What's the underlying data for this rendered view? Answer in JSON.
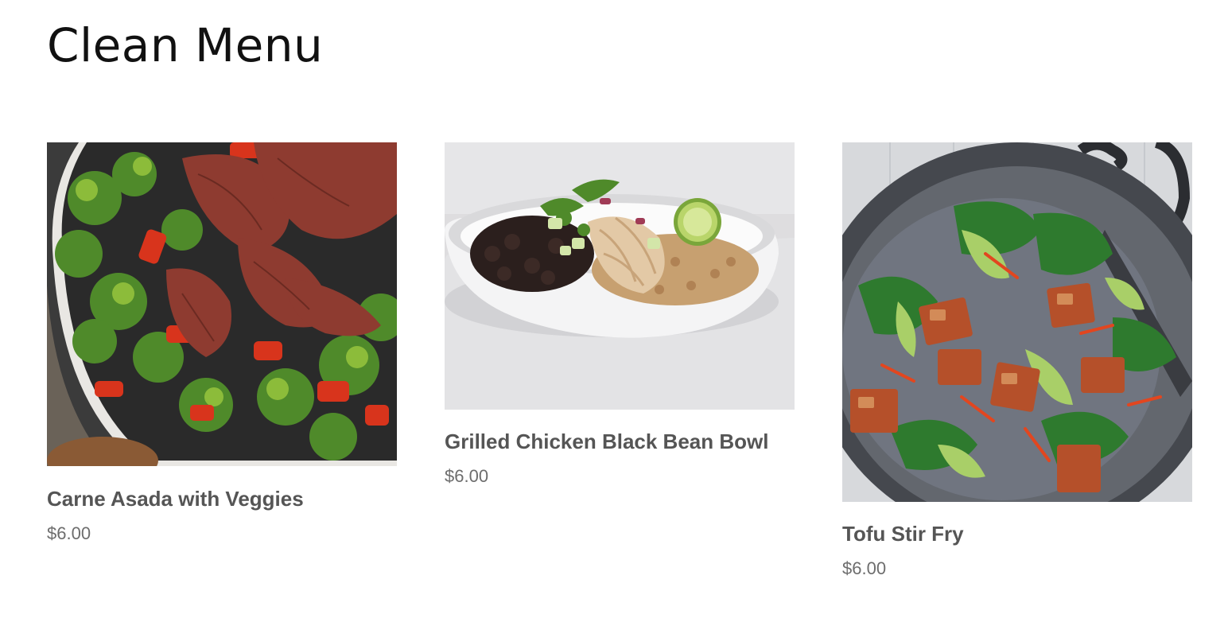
{
  "page": {
    "title": "Clean Menu"
  },
  "menu": {
    "items": [
      {
        "name": "Carne Asada with Veggies",
        "price": "$6.00"
      },
      {
        "name": "Grilled Chicken Black Bean Bowl",
        "price": "$6.00"
      },
      {
        "name": "Tofu Stir Fry",
        "price": "$6.00"
      }
    ]
  },
  "colors": {
    "title": "#111111",
    "item_name": "#555555",
    "item_price": "#6d6d6d",
    "background": "#ffffff"
  }
}
